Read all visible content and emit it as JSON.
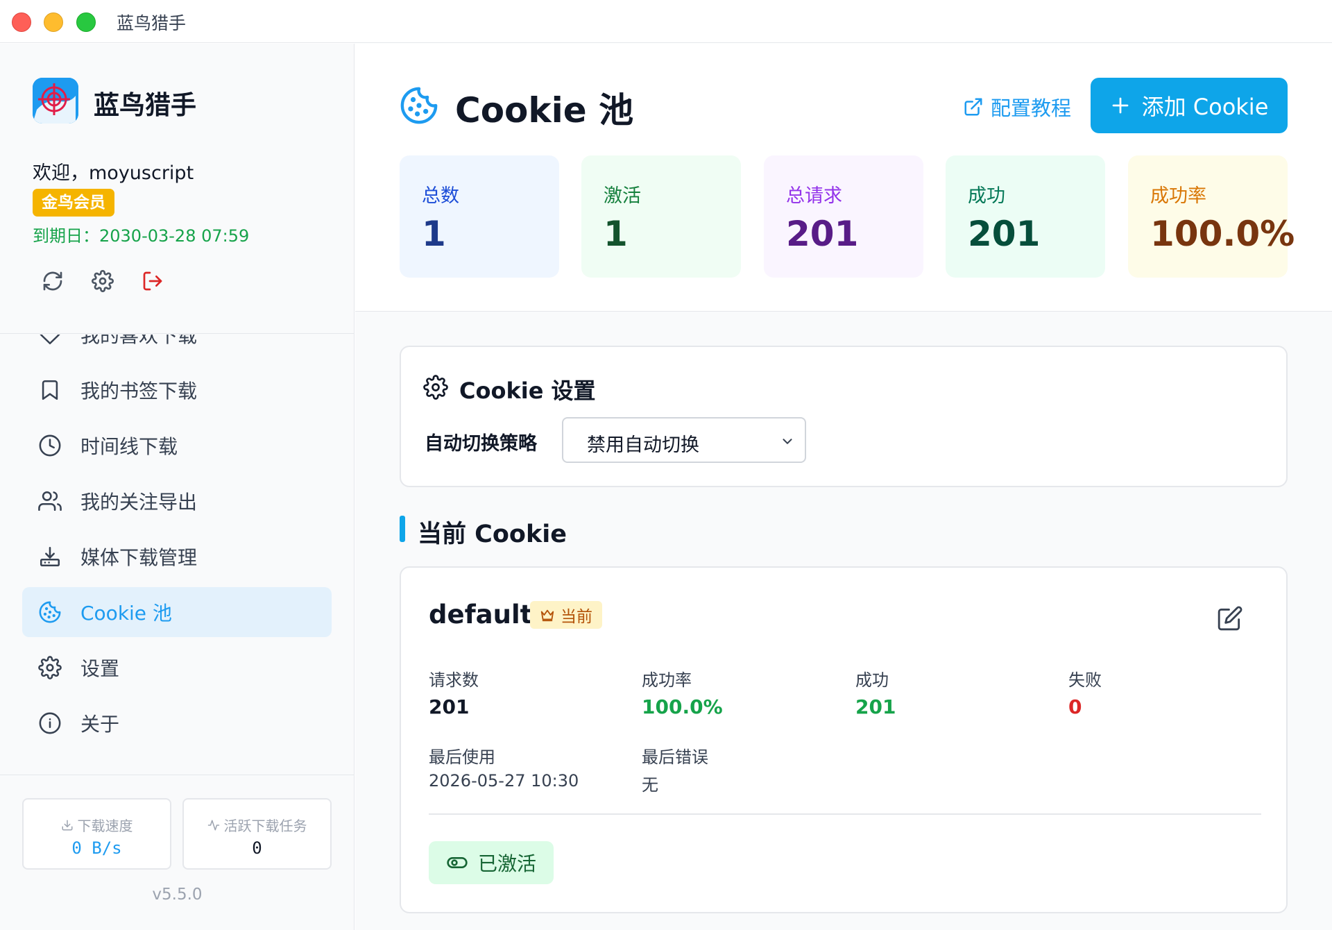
{
  "window": {
    "title": "蓝鸟猎手"
  },
  "sidebar": {
    "brand_name": "蓝鸟猎手",
    "welcome": "欢迎，moyuscript",
    "member_badge": "金鸟会员",
    "expiry": "到期日：2030-03-28 07:59",
    "tools": [
      {
        "icon": "refresh-icon"
      },
      {
        "icon": "gear-icon"
      },
      {
        "icon": "logout-icon"
      }
    ],
    "nav": [
      {
        "label": "我的喜欢下载",
        "icon": "heart-icon"
      },
      {
        "label": "我的书签下载",
        "icon": "bookmark-icon"
      },
      {
        "label": "时间线下载",
        "icon": "clock-icon"
      },
      {
        "label": "我的关注导出",
        "icon": "users-icon"
      },
      {
        "label": "媒体下载管理",
        "icon": "download-tray-icon"
      },
      {
        "label": "Cookie 池",
        "icon": "cookie-icon",
        "active": true
      },
      {
        "label": "设置",
        "icon": "gear-icon"
      },
      {
        "label": "关于",
        "icon": "info-icon"
      }
    ],
    "download_speed": {
      "label": "下载速度",
      "value": "0 B/s",
      "icon": "download-icon"
    },
    "active_tasks": {
      "label": "活跃下载任务",
      "value": "0",
      "icon": "activity-icon"
    },
    "version": "v5.5.0"
  },
  "header": {
    "title": "Cookie 池",
    "tutorial_link": "配置教程",
    "add_button": "添加 Cookie"
  },
  "metrics": [
    {
      "label": "总数",
      "value": "1"
    },
    {
      "label": "激活",
      "value": "1"
    },
    {
      "label": "总请求",
      "value": "201"
    },
    {
      "label": "成功",
      "value": "201"
    },
    {
      "label": "成功率",
      "value": "100.0%"
    }
  ],
  "settings": {
    "title": "Cookie 设置",
    "strategy_label": "自动切换策略",
    "strategy_value": "禁用自动切换"
  },
  "current_section": {
    "title": "当前 Cookie"
  },
  "cookie": {
    "name": "default",
    "badge": "当前",
    "stats": [
      {
        "label": "请求数",
        "value": "201"
      },
      {
        "label": "成功率",
        "value": "100.0%"
      },
      {
        "label": "成功",
        "value": "201"
      },
      {
        "label": "失败",
        "value": "0"
      }
    ],
    "last_used_label": "最后使用",
    "last_used_value": "2026-05-27 10:30",
    "last_error_label": "最后错误",
    "last_error_value": "无",
    "status": "已激活"
  },
  "colors": {
    "accent": "#1d9bf0",
    "success": "#16a34a",
    "danger": "#dc2626",
    "gold": "#f5b400"
  }
}
